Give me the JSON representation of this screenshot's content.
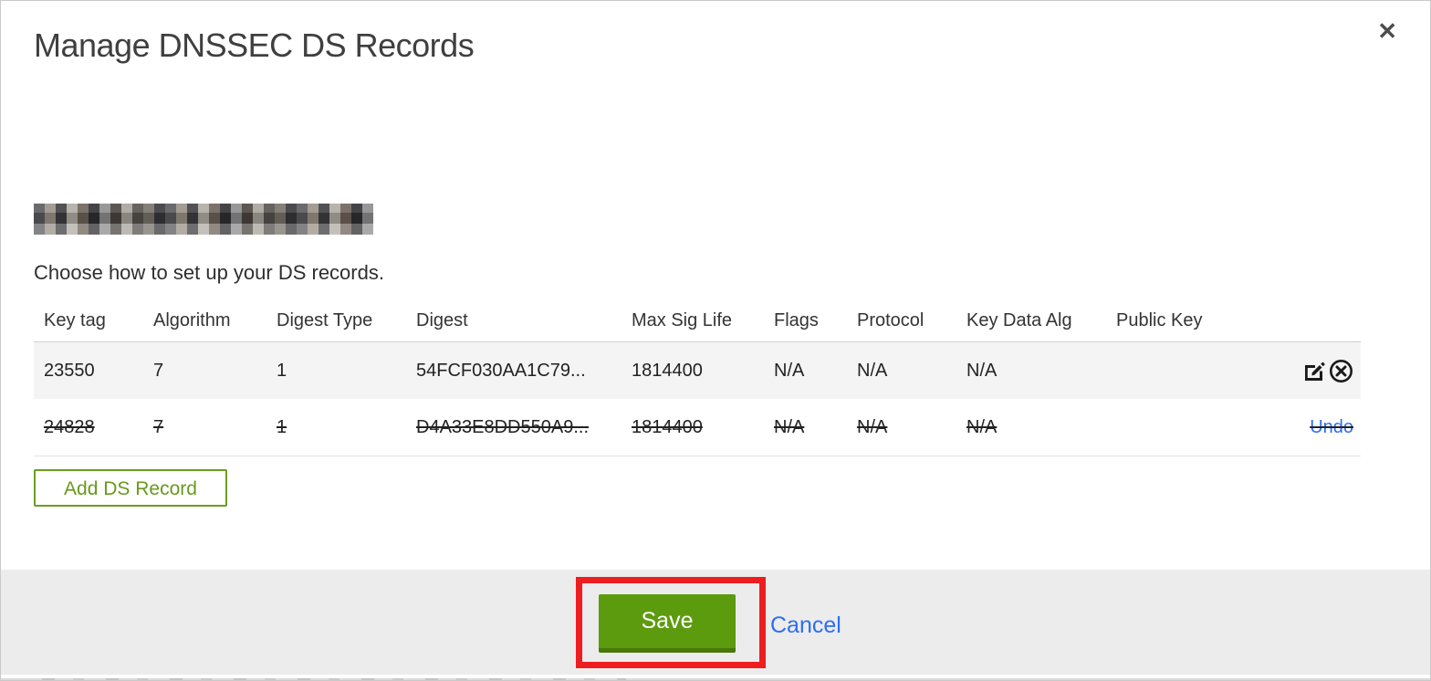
{
  "modal": {
    "title": "Manage DNSSEC DS Records",
    "close_icon": "✕",
    "subtitle": "Choose how to set up your DS records.",
    "add_button_label": "Add DS Record",
    "save_button_label": "Save",
    "cancel_label": "Cancel"
  },
  "table": {
    "columns": [
      "Key tag",
      "Algorithm",
      "Digest Type",
      "Digest",
      "Max Sig Life",
      "Flags",
      "Protocol",
      "Key Data Alg",
      "Public Key"
    ],
    "rows": [
      {
        "key_tag": "23550",
        "algorithm": "7",
        "digest_type": "1",
        "digest": "54FCF030AA1C79...",
        "max_sig_life": "1814400",
        "flags": "N/A",
        "protocol": "N/A",
        "key_data_alg": "N/A",
        "public_key": "",
        "state": "normal",
        "actions": [
          "edit",
          "delete"
        ]
      },
      {
        "key_tag": "24828",
        "algorithm": "7",
        "digest_type": "1",
        "digest": "D4A33E8DD550A9...",
        "max_sig_life": "1814400",
        "flags": "N/A",
        "protocol": "N/A",
        "key_data_alg": "N/A",
        "public_key": "",
        "state": "deleted",
        "undo_label": "Undo"
      }
    ]
  },
  "colors": {
    "accent_green": "#5d9b0e",
    "outline_green": "#6b9e22",
    "link_blue": "#2d6ef0",
    "annotation_red": "#ee1d1f",
    "footer_gray": "#ececec",
    "row_gray": "#f4f4f4"
  }
}
